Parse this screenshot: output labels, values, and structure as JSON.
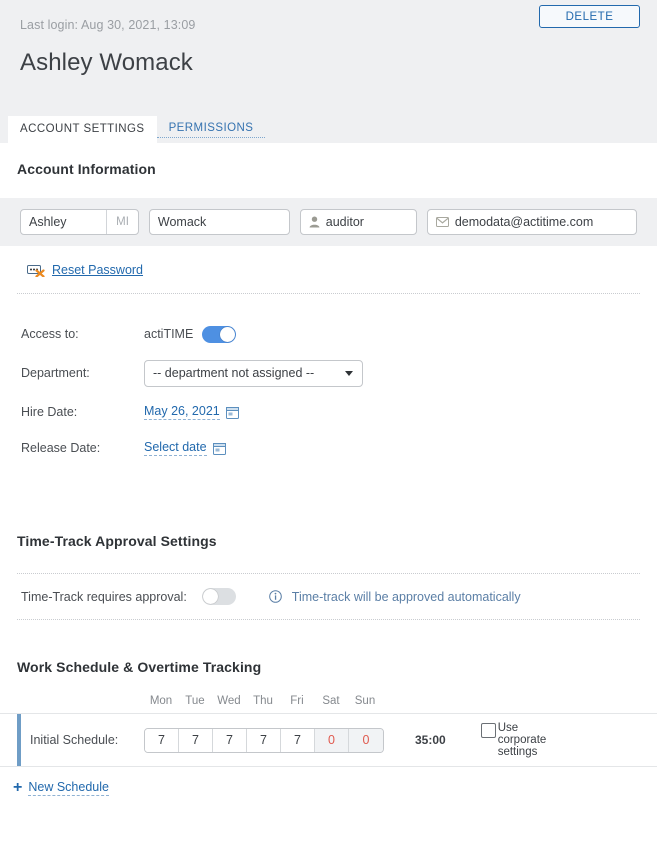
{
  "header": {
    "last_login": "Last login: Aug 30, 2021, 13:09",
    "user_name": "Ashley Womack",
    "delete_label": "DELETE",
    "tabs": [
      {
        "label": "ACCOUNT SETTINGS",
        "active": true
      },
      {
        "label": "PERMISSIONS",
        "active": false
      }
    ]
  },
  "account_information": {
    "title": "Account Information",
    "first_name": "Ashley",
    "middle_initial_placeholder": "MI",
    "last_name": "Womack",
    "username": "auditor",
    "email": "demodata@actitime.com",
    "reset_password_label": "Reset Password",
    "icons": {
      "username": "user-icon",
      "email": "envelope-icon",
      "reset_password": "password-reset-icon"
    }
  },
  "access": {
    "label": "Access to:",
    "product": "actiTIME",
    "toggle_state": "on"
  },
  "department": {
    "label": "Department:",
    "selected": "-- department not assigned --"
  },
  "hire_date": {
    "label": "Hire Date:",
    "value": "May 26, 2021"
  },
  "release_date": {
    "label": "Release Date:",
    "value": "Select date"
  },
  "time_track_approval": {
    "title": "Time-Track Approval Settings",
    "label": "Time-Track requires approval:",
    "toggle_state": "off",
    "note": "Time-track will be approved automatically"
  },
  "work_schedule": {
    "title": "Work Schedule & Overtime Tracking",
    "day_headers": [
      "Mon",
      "Tue",
      "Wed",
      "Thu",
      "Fri",
      "Sat",
      "Sun"
    ],
    "row_label": "Initial Schedule:",
    "hours": [
      "7",
      "7",
      "7",
      "7",
      "7",
      "0",
      "0"
    ],
    "weekend_flags": [
      false,
      false,
      false,
      false,
      false,
      true,
      true
    ],
    "total": "35:00",
    "use_corporate_label": "Use corporate settings",
    "use_corporate_checked": false,
    "new_schedule_label": "New Schedule"
  },
  "colors": {
    "accent_blue": "#2269ad",
    "toggle_on": "#4e90e2",
    "band_gray": "#eff0f2",
    "weekend_red": "#e05a4f",
    "schedule_bar": "#6f9dc6"
  }
}
